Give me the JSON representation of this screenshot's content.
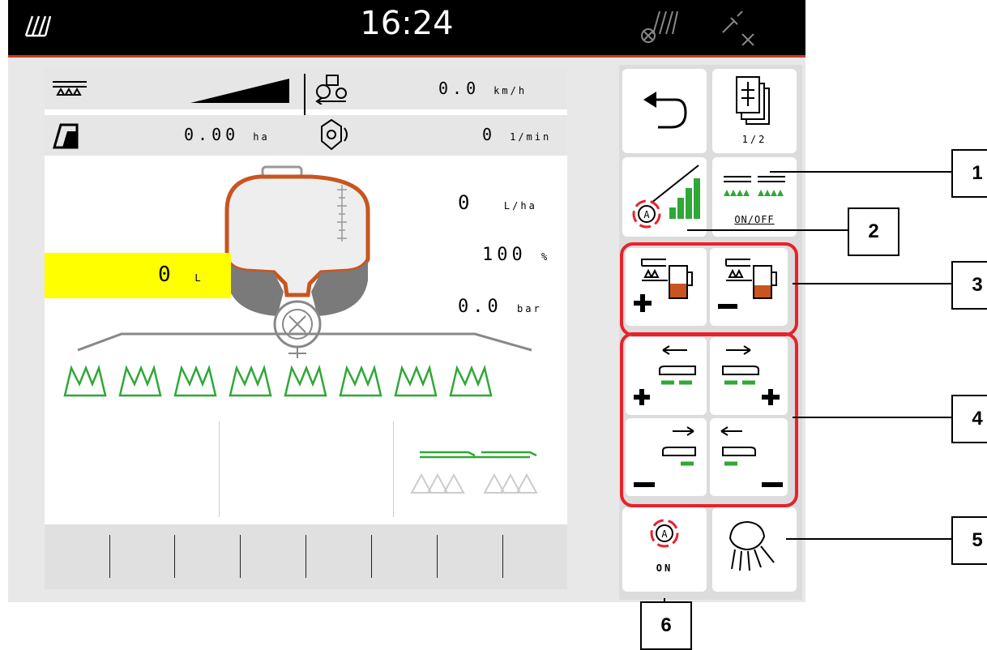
{
  "status_bar": {
    "time": "16:24"
  },
  "info": {
    "speed_value": "0.0",
    "speed_unit": "km/h",
    "area_value": "0.00",
    "area_unit": "ha",
    "pto_value": "0",
    "pto_unit": "1/min"
  },
  "main": {
    "rate_value": "0",
    "rate_unit": "L/ha",
    "percent_value": "100",
    "percent_unit": "%",
    "pressure_value": "0.0",
    "pressure_unit": "bar",
    "tank_value": "0",
    "tank_unit": "L"
  },
  "buttons": {
    "page_label": "1/2",
    "boom_onoff_label": "ON/OFF",
    "auto_label": "ON"
  },
  "callouts": [
    "1",
    "2",
    "3",
    "4",
    "5",
    "6"
  ],
  "colors": {
    "accent_red": "#e8222a",
    "green": "#2ea836",
    "tank_orange": "#c8551f",
    "highlight_yellow": "#ffff00"
  }
}
